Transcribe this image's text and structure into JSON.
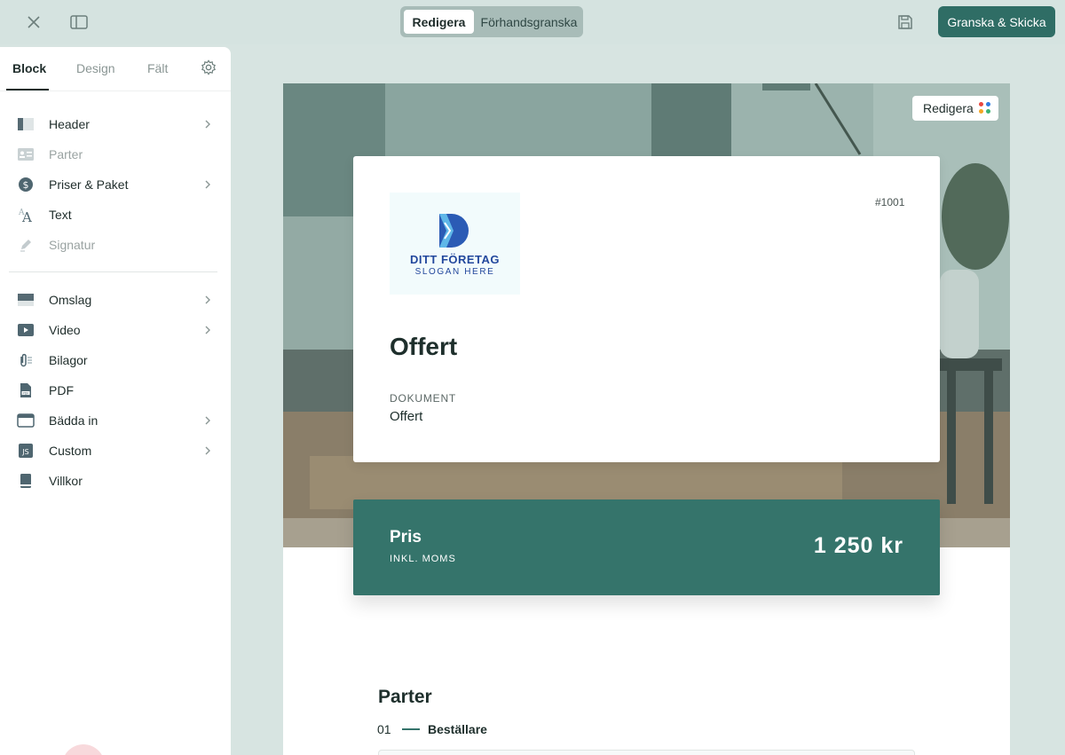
{
  "topbar": {
    "mode_edit": "Redigera",
    "mode_preview": "Förhandsgranska",
    "primary_action": "Granska & Skicka"
  },
  "sidebar": {
    "tabs": [
      "Block",
      "Design",
      "Fält"
    ],
    "items": [
      {
        "label": "Header",
        "icon": "header-icon",
        "chevron": true,
        "dim": false
      },
      {
        "label": "Parter",
        "icon": "contact-card-icon",
        "chevron": false,
        "dim": true
      },
      {
        "label": "Priser & Paket",
        "icon": "dollar-icon",
        "chevron": true,
        "dim": false
      },
      {
        "label": "Text",
        "icon": "text-icon",
        "chevron": false,
        "dim": false
      },
      {
        "label": "Signatur",
        "icon": "pen-icon",
        "chevron": false,
        "dim": true
      },
      {
        "label": "Omslag",
        "icon": "cover-icon",
        "chevron": true,
        "dim": false
      },
      {
        "label": "Video",
        "icon": "video-icon",
        "chevron": true,
        "dim": false
      },
      {
        "label": "Bilagor",
        "icon": "paperclip-icon",
        "chevron": false,
        "dim": false
      },
      {
        "label": "PDF",
        "icon": "pdf-icon",
        "chevron": false,
        "dim": false
      },
      {
        "label": "Bädda in",
        "icon": "embed-icon",
        "chevron": true,
        "dim": false
      },
      {
        "label": "Custom",
        "icon": "js-icon",
        "chevron": true,
        "dim": false
      },
      {
        "label": "Villkor",
        "icon": "book-icon",
        "chevron": false,
        "dim": false
      }
    ]
  },
  "hero": {
    "edit_label": "Redigera",
    "dot_colors": [
      "#e8473f",
      "#2f7de1",
      "#f4a623",
      "#3bb273"
    ]
  },
  "document": {
    "logo_name": "DITT FÖRETAG",
    "logo_slogan": "SLOGAN HERE",
    "number": "#1001",
    "title": "Offert",
    "field_label": "DOKUMENT",
    "field_value": "Offert"
  },
  "price": {
    "title": "Pris",
    "subtitle": "INKL. MOMS",
    "value": "1 250 kr"
  },
  "parties": {
    "title": "Parter",
    "index": "01",
    "role": "Beställare"
  },
  "colors": {
    "accent": "#2f6d65",
    "price_band": "#35746b",
    "logo_blue": "#23489d"
  }
}
